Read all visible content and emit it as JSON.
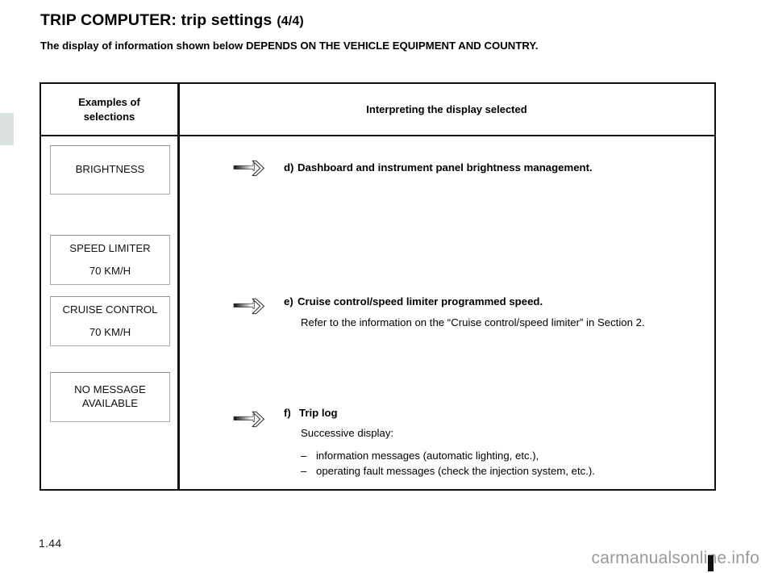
{
  "document": {
    "title_main": "TRIP COMPUTER: trip settings",
    "title_fraction": "(4/4)",
    "subtitle": "The display of information shown below DEPENDS ON THE VEHICLE EQUIPMENT AND COUNTRY.",
    "page_number": "1.44",
    "watermark": "carmanualsonline.info"
  },
  "table": {
    "headers": {
      "left_line1": "Examples of",
      "left_line2": "selections",
      "right": "Interpreting the display selected"
    },
    "display_boxes": [
      {
        "id": "brightness",
        "line1": "BRIGHTNESS",
        "line2": ""
      },
      {
        "id": "speed-limiter",
        "line1": "SPEED LIMITER",
        "line2": "70 KM/H"
      },
      {
        "id": "cruise-control",
        "line1": "CRUISE CONTROL",
        "line2": "70 KM/H"
      },
      {
        "id": "no-message",
        "line1": "NO MESSAGE",
        "line2": "AVAILABLE"
      }
    ],
    "entries": [
      {
        "marker": "d)",
        "heading": "Dashboard and instrument panel brightness management.",
        "sub": "",
        "bullets": []
      },
      {
        "marker": "e)",
        "heading": "Cruise control/speed limiter programmed speed.",
        "sub": "Refer to the information on the “Cruise control/speed limiter” in Section 2.",
        "bullets": []
      },
      {
        "marker": "f)",
        "heading": "Trip log",
        "sub": "Successive display:",
        "bullets": [
          {
            "dash": "–",
            "text": "information messages (automatic lighting, etc.),"
          },
          {
            "dash": "–",
            "text": "operating fault messages (check the injection system, etc.)."
          }
        ]
      }
    ]
  },
  "icons": {
    "arrow": "arrow-pointer-icon"
  },
  "colors": {
    "text": "#000000",
    "table_border": "#111111",
    "box_border": "#a9a9a9",
    "section_tab": "#dbe0e0",
    "watermark": "#9a9a9a"
  }
}
